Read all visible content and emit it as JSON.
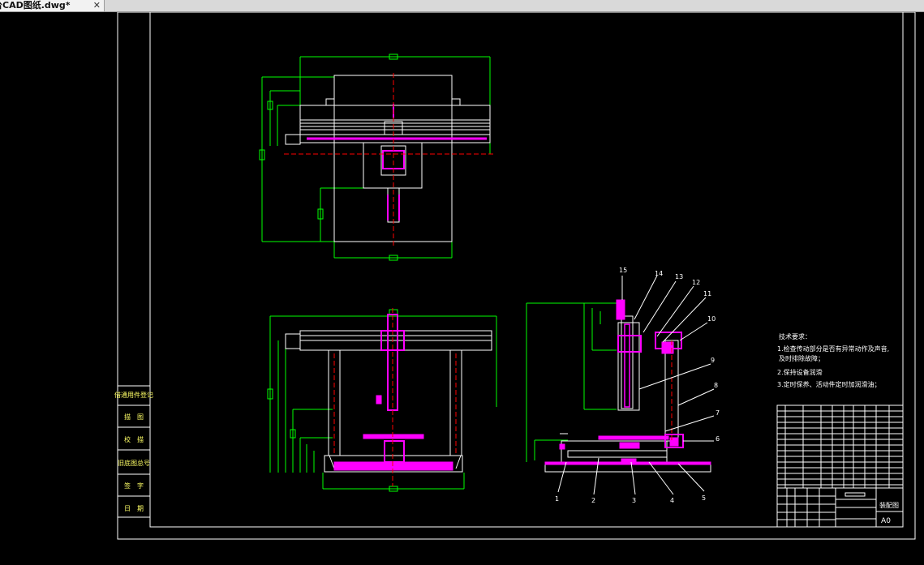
{
  "tab": {
    "title": "台CAD图纸.dwg*",
    "close_glyph": "✕"
  },
  "colors": {
    "tab_bg": "#f2f2f2",
    "canvas_bg": "#000000",
    "outline": "#ffffff",
    "dimension": "#00ff00",
    "part": "#ff00ff",
    "centerline": "#ff0000"
  },
  "left_block": {
    "rows": [
      "借通用件登记",
      "描　图",
      "校　描",
      "旧底图总号",
      "签　字",
      "日　期"
    ]
  },
  "part_numbers": [
    "15",
    "14",
    "13",
    "12",
    "11",
    "10",
    "9",
    "8",
    "7",
    "6",
    "1",
    "2",
    "3",
    "4",
    "5"
  ],
  "tech_notes": {
    "title": "技术要求：",
    "lines": [
      "1.检查传动部分是否有异常动作及声音,",
      "及时排除故障；",
      "2.保持设备润滑",
      "3.定时保养、活动件定时加润滑油；"
    ]
  },
  "title_block": {
    "drawing_name": "装配图",
    "sheet_size": "A0"
  }
}
